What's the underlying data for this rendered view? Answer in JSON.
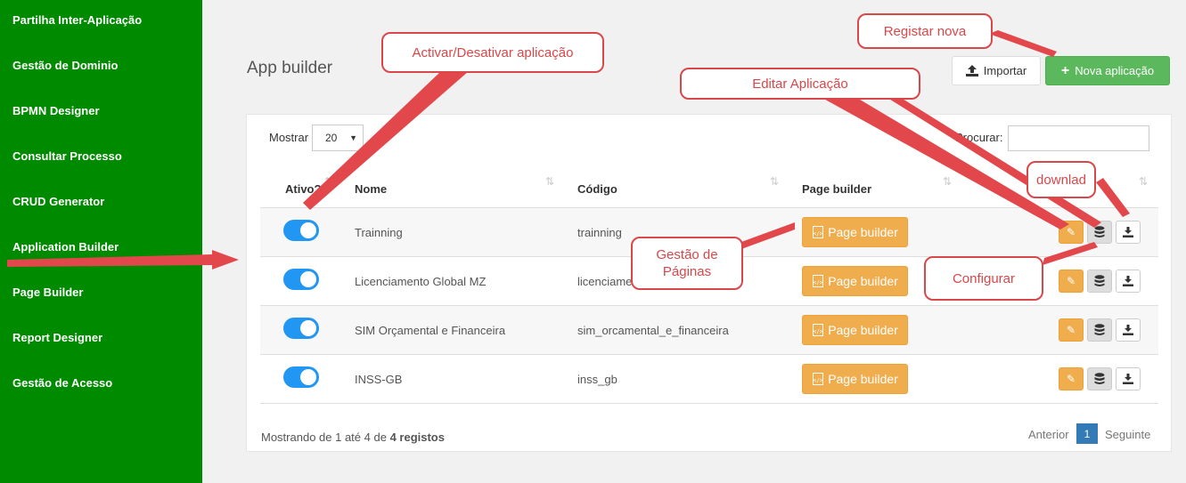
{
  "sidebar": {
    "items": [
      {
        "label": "Partilha Inter-Aplicação"
      },
      {
        "label": "Gestão de Dominio"
      },
      {
        "label": "BPMN Designer"
      },
      {
        "label": "Consultar Processo"
      },
      {
        "label": "CRUD Generator"
      },
      {
        "label": "Application Builder"
      },
      {
        "label": "Page Builder"
      },
      {
        "label": "Report Designer"
      },
      {
        "label": "Gestão de Acesso"
      }
    ]
  },
  "header": {
    "title": "App builder",
    "import_label": "Importar",
    "new_label": "Nova aplicação"
  },
  "table_controls": {
    "show_label": "Mostrar",
    "page_size": "20",
    "search_label": "Procurar:"
  },
  "columns": {
    "active": "Ativo?",
    "name": "Nome",
    "code": "Código",
    "page_builder": "Page builder"
  },
  "rows": [
    {
      "active": true,
      "name": "Trainning",
      "code": "trainning",
      "action": "Page builder"
    },
    {
      "active": true,
      "name": "Licenciamento Global MZ",
      "code": "licenciame",
      "action": "Page builder"
    },
    {
      "active": true,
      "name": "SIM Orçamental e Financeira",
      "code": "sim_orcamental_e_financeira",
      "action": "Page builder"
    },
    {
      "active": true,
      "name": "INSS-GB",
      "code": "inss_gb",
      "action": "Page builder"
    }
  ],
  "footer": {
    "info_prefix": "Mostrando de 1 até 4 de",
    "info_bold": "4 registos",
    "prev": "Anterior",
    "page": "1",
    "next": "Seguinte"
  },
  "callouts": {
    "activate": "Activar/Desativar aplicação",
    "register": "Registar nova",
    "edit": "Editar Aplicação",
    "download": "downlad",
    "pages": "Gestão de Páginas",
    "configure": "Configurar"
  },
  "colors": {
    "sidebar": "#008a00",
    "primary_toggle": "#2196f3",
    "warning": "#f0ad4e",
    "success": "#5cb85c",
    "annotation": "#d9474a"
  }
}
